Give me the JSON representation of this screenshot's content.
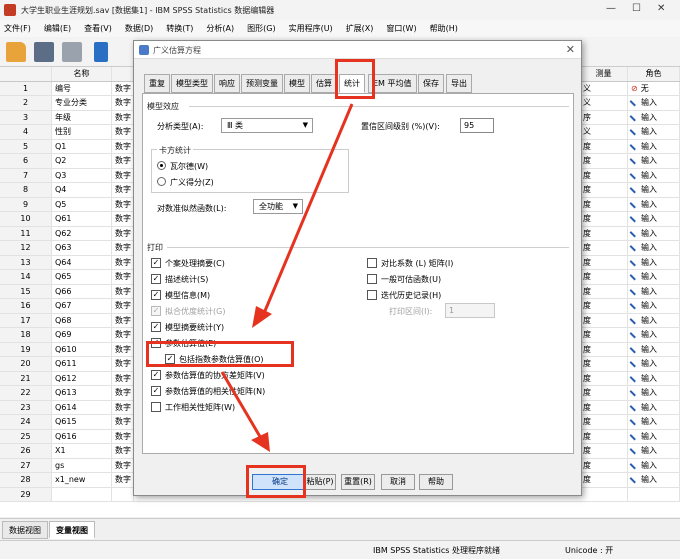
{
  "window": {
    "title": "大学生职业生涯规划.sav [数据集1] - IBM SPSS Statistics 数据编辑器"
  },
  "menu": [
    "文件(F)",
    "编辑(E)",
    "查看(V)",
    "数据(D)",
    "转换(T)",
    "分析(A)",
    "图形(G)",
    "实用程序(U)",
    "扩展(X)",
    "窗口(W)",
    "帮助(H)"
  ],
  "toolbar_icons": [
    "open-folder-icon",
    "save-icon",
    "print-icon",
    "recall-dialog-icon"
  ],
  "grid": {
    "headers": {
      "name": "名称",
      "measure": "测量",
      "role": "角色"
    },
    "rows": [
      {
        "num": "1",
        "name": "编号",
        "type": "数字",
        "measure": "义",
        "role": "无",
        "role_icon": "none-icon"
      },
      {
        "num": "2",
        "name": "专业分类",
        "type": "数字",
        "measure": "义",
        "role": "输入"
      },
      {
        "num": "3",
        "name": "年级",
        "type": "数字",
        "measure": "序",
        "role": "输入"
      },
      {
        "num": "4",
        "name": "性别",
        "type": "数字",
        "measure": "义",
        "role": "输入"
      },
      {
        "num": "5",
        "name": "Q1",
        "type": "数字",
        "measure": "度",
        "role": "输入"
      },
      {
        "num": "6",
        "name": "Q2",
        "type": "数字",
        "measure": "度",
        "role": "输入"
      },
      {
        "num": "7",
        "name": "Q3",
        "type": "数字",
        "measure": "度",
        "role": "输入"
      },
      {
        "num": "8",
        "name": "Q4",
        "type": "数字",
        "measure": "度",
        "role": "输入"
      },
      {
        "num": "9",
        "name": "Q5",
        "type": "数字",
        "measure": "度",
        "role": "输入"
      },
      {
        "num": "10",
        "name": "Q61",
        "type": "数字",
        "measure": "度",
        "role": "输入"
      },
      {
        "num": "11",
        "name": "Q62",
        "type": "数字",
        "measure": "度",
        "role": "输入"
      },
      {
        "num": "12",
        "name": "Q63",
        "type": "数字",
        "measure": "度",
        "role": "输入"
      },
      {
        "num": "13",
        "name": "Q64",
        "type": "数字",
        "measure": "度",
        "role": "输入"
      },
      {
        "num": "14",
        "name": "Q65",
        "type": "数字",
        "measure": "度",
        "role": "输入"
      },
      {
        "num": "15",
        "name": "Q66",
        "type": "数字",
        "measure": "度",
        "role": "输入"
      },
      {
        "num": "16",
        "name": "Q67",
        "type": "数字",
        "measure": "度",
        "role": "输入"
      },
      {
        "num": "17",
        "name": "Q68",
        "type": "数字",
        "measure": "度",
        "role": "输入"
      },
      {
        "num": "18",
        "name": "Q69",
        "type": "数字",
        "measure": "度",
        "role": "输入"
      },
      {
        "num": "19",
        "name": "Q610",
        "type": "数字",
        "measure": "度",
        "role": "输入"
      },
      {
        "num": "20",
        "name": "Q611",
        "type": "数字",
        "measure": "度",
        "role": "输入"
      },
      {
        "num": "21",
        "name": "Q612",
        "type": "数字",
        "measure": "度",
        "role": "输入"
      },
      {
        "num": "22",
        "name": "Q613",
        "type": "数字",
        "measure": "度",
        "role": "输入"
      },
      {
        "num": "23",
        "name": "Q614",
        "type": "数字",
        "measure": "度",
        "role": "输入"
      },
      {
        "num": "24",
        "name": "Q615",
        "type": "数字",
        "measure": "度",
        "role": "输入"
      },
      {
        "num": "25",
        "name": "Q616",
        "type": "数字",
        "measure": "度",
        "role": "输入"
      },
      {
        "num": "26",
        "name": "X1",
        "type": "数字",
        "measure": "度",
        "role": "输入"
      },
      {
        "num": "27",
        "name": "gs",
        "type": "数字",
        "measure": "度",
        "role": "输入"
      },
      {
        "num": "28",
        "name": "x1_new",
        "type": "数字",
        "measure": "度",
        "role": "输入"
      },
      {
        "num": "29",
        "name": "",
        "type": "",
        "measure": "",
        "role": ""
      }
    ]
  },
  "bottom_tabs": {
    "data_view": "数据视图",
    "variable_view": "变量视图"
  },
  "status": {
    "processor": "IBM SPSS Statistics 处理程序就绪",
    "unicode": "Unicode : 开"
  },
  "dialog": {
    "title": "广义估算方程",
    "tabs": [
      "重复",
      "模型类型",
      "响应",
      "预测变量",
      "模型",
      "估算",
      "统计",
      "EM 平均值",
      "保存",
      "导出"
    ],
    "active_tab": "统计",
    "model_effects": {
      "heading": "模型效应",
      "analysis_type_label": "分析类型(A):",
      "analysis_type_value": "Ⅲ 类",
      "ci_label": "置信区间级别 (%)(V):",
      "ci_value": "95",
      "chisq_heading": "卡方统计",
      "wald": "瓦尔德(W)",
      "gscore": "广义得分(Z)",
      "lr_label": "对数准似然函数(L):",
      "lr_value": "全功能"
    },
    "print": {
      "heading": "打印",
      "left": [
        {
          "label": "个案处理摘要(C)",
          "checked": true,
          "enabled": true
        },
        {
          "label": "描述统计(S)",
          "checked": true,
          "enabled": true
        },
        {
          "label": "模型信息(M)",
          "checked": true,
          "enabled": true
        },
        {
          "label": "拟合优度统计(G)",
          "checked": true,
          "enabled": false
        },
        {
          "label": "模型摘要统计(Y)",
          "checked": true,
          "enabled": true
        },
        {
          "label": "参数估算值(E)",
          "checked": true,
          "enabled": true
        },
        {
          "label": "包括指数参数估算值(O)",
          "checked": true,
          "enabled": true
        },
        {
          "label": "参数估算值的协方差矩阵(V)",
          "checked": true,
          "enabled": true
        },
        {
          "label": "参数估算值的相关性矩阵(N)",
          "checked": true,
          "enabled": true
        },
        {
          "label": "工作相关性矩阵(W)",
          "checked": false,
          "enabled": true
        }
      ],
      "right": [
        {
          "label": "对比系数 (L) 矩阵(I)",
          "checked": false
        },
        {
          "label": "一般可估函数(U)",
          "checked": false
        },
        {
          "label": "迭代历史记录(H)",
          "checked": false
        }
      ],
      "print_interval_label": "打印区间(I):",
      "print_interval_value": "1"
    },
    "buttons": {
      "ok": "确定",
      "paste": "粘贴(P)",
      "reset": "重置(R)",
      "cancel": "取消",
      "help": "帮助"
    }
  },
  "colors": {
    "annotation_red": "#e53320",
    "ok_blue": "#2f74d0"
  }
}
